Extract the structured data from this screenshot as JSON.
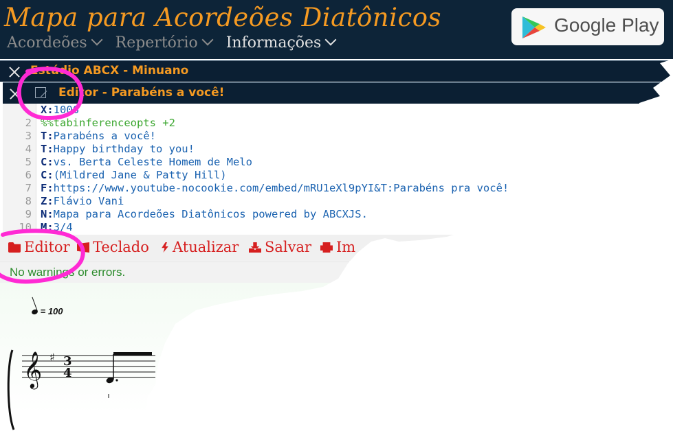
{
  "header": {
    "app_title": "Mapa para Acordeões Diatônicos",
    "nav": [
      "Acordeões",
      "Repertório",
      "Informações"
    ],
    "store_badge": "Google Play",
    "store_icon": "google-play-icon"
  },
  "studio": {
    "title": "Estúdio ABCX - Minuano",
    "close_icon": "close-icon"
  },
  "editor": {
    "title": "Editor - Parabéns a você!",
    "close_icon": "close-icon",
    "popout_icon": "popout-icon"
  },
  "code": {
    "lines": [
      {
        "n": "",
        "key": "X:",
        "text": "1006"
      },
      {
        "n": "2",
        "key": "",
        "text": "%%tabinferenceopts +2"
      },
      {
        "n": "3",
        "key": "T:",
        "text": "Parabéns a você!"
      },
      {
        "n": "4",
        "key": "T:",
        "text": "Happy birthday to you!"
      },
      {
        "n": "5",
        "key": "C:",
        "text": "vs. Berta Celeste Homem de Melo"
      },
      {
        "n": "6",
        "key": "C:",
        "text": "(Mildred Jane & Patty Hill)"
      },
      {
        "n": "7",
        "key": "F:",
        "text": "https://www.youtube-nocookie.com/embed/mRU1eXl9pYI&T:Parabéns pra você!"
      },
      {
        "n": "8",
        "key": "Z:",
        "text": "Flávio Vani"
      },
      {
        "n": "9",
        "key": "N:",
        "text": "Mapa para Acordeões Diatônicos powered by ABCXJS."
      },
      {
        "n": "10",
        "key": "M:",
        "text": "3/4"
      }
    ]
  },
  "toolbar": {
    "editor": "Editor",
    "teclado": "Teclado",
    "atualizar": "Atualizar",
    "salvar": "Salvar",
    "imprimir": "Im"
  },
  "status": {
    "message": "No warnings or errors."
  },
  "music": {
    "tempo": "= 100",
    "time_top": "3",
    "time_bottom": "4"
  },
  "colors": {
    "header_bg": "#0d2438",
    "accent_orange": "#f59a22",
    "toolbar_red": "#d61f1f",
    "status_green": "#2a8a2a",
    "annotation_magenta": "#ff2ad4"
  }
}
